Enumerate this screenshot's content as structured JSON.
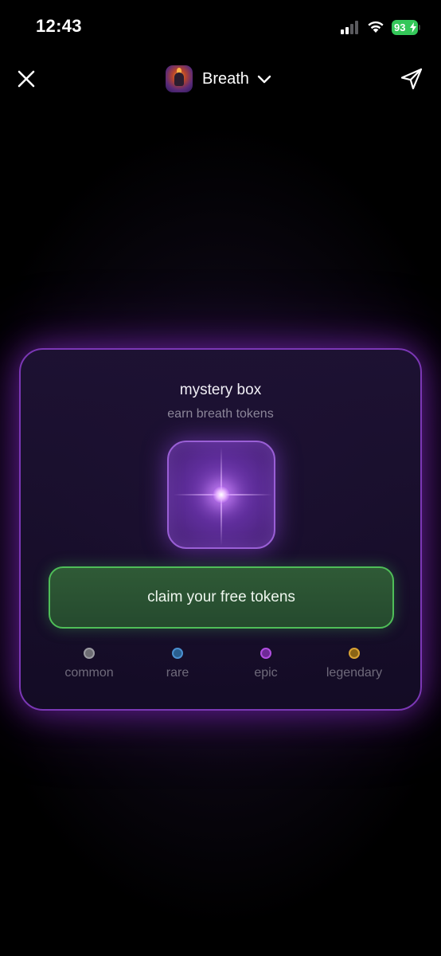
{
  "status_bar": {
    "time": "12:43",
    "battery_percent": "93",
    "signal_icon": "cellular-signal-icon",
    "wifi_icon": "wifi-icon",
    "battery_icon": "battery-charging-icon"
  },
  "header": {
    "close_icon": "close-icon",
    "app_icon": "breath-app-icon",
    "title": "Breath",
    "chevron_icon": "chevron-down-icon",
    "share_icon": "send-icon"
  },
  "card": {
    "title": "mystery box",
    "subtitle": "earn breath tokens",
    "box_icon": "mystery-box-sparkle-icon",
    "claim_label": "claim your free tokens",
    "tiers": [
      {
        "label": "common",
        "color": "#8e8e95"
      },
      {
        "label": "rare",
        "color": "#3d86c9"
      },
      {
        "label": "epic",
        "color": "#a640d6"
      },
      {
        "label": "legendary",
        "color": "#d19a2b"
      }
    ]
  },
  "colors": {
    "accent_purple": "#7b37b5",
    "claim_green": "#4fbe58",
    "battery_green": "#34c759"
  }
}
